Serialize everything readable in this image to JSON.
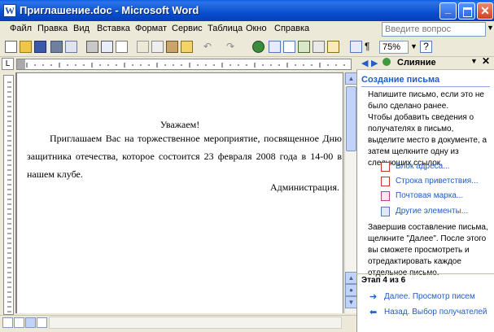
{
  "window": {
    "title": "Приглашение.doc - Microsoft Word",
    "app_icon_letter": "W"
  },
  "menu": {
    "items": [
      "Файл",
      "Правка",
      "Вид",
      "Вставка",
      "Формат",
      "Сервис",
      "Таблица",
      "Окно",
      "Справка"
    ],
    "help_placeholder": "Введите вопрос"
  },
  "toolbar": {
    "zoom": "75%"
  },
  "document": {
    "greeting": "Уважаем!",
    "body": "Приглашаем Вас на торжественное мероприятие, посвященное Дню защитника отечества, которое состоится 23 февраля 2008 года в 14-00 в нашем клубе.",
    "signature": "Администрация."
  },
  "task_pane": {
    "title": "Слияние",
    "section_title": "Создание письма",
    "intro": "Напишите письмо, если это не было сделано ранее.",
    "instructions": "Чтобы добавить сведения о получателях в письмо, выделите место в документе, а затем щелкните одну из следующих ссылок.",
    "links": [
      "Блок адреса...",
      "Строка приветствия...",
      "Почтовая марка...",
      "Другие элементы..."
    ],
    "finish_text": "Завершив составление письма, щелкните \"Далее\". После этого вы сможете просмотреть и отредактировать каждое отдельное письмо.",
    "step": "Этап 4 из 6",
    "next": "Далее. Просмотр писем",
    "back": "Назад. Выбор получателей"
  },
  "colors": {
    "titlebar": "#0a5ee6",
    "link": "#215dc6",
    "chrome": "#ece9d8"
  }
}
